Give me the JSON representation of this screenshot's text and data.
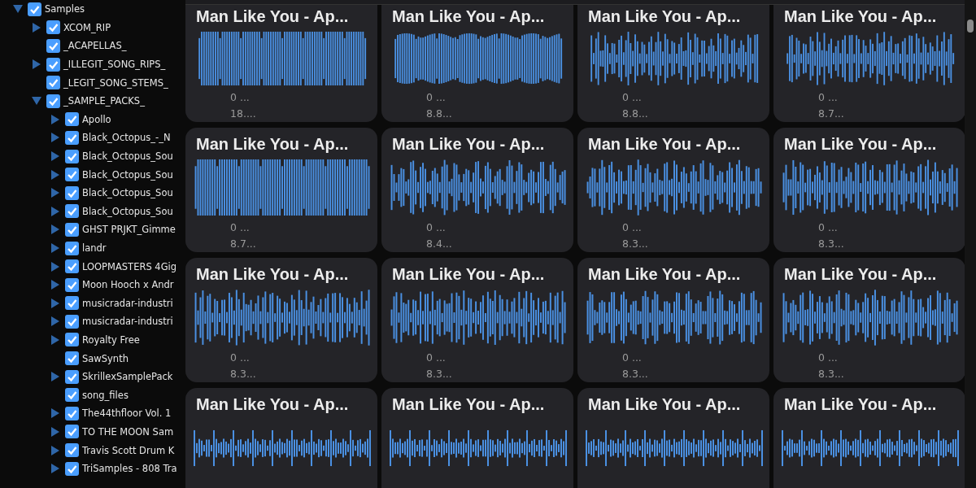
{
  "tree": {
    "label": "Samples",
    "checked": true,
    "expandable": true,
    "expanded": true,
    "children": [
      {
        "label": "XCOM_RIP",
        "checked": true,
        "expandable": true,
        "expanded": false
      },
      {
        "label": "_ACAPELLAS_",
        "checked": true,
        "expandable": false
      },
      {
        "label": "_ILLEGIT_SONG_RIPS_",
        "checked": true,
        "expandable": true,
        "expanded": false
      },
      {
        "label": "_LEGIT_SONG_STEMS_",
        "checked": true,
        "expandable": false
      },
      {
        "label": "_SAMPLE_PACKS_",
        "checked": true,
        "expandable": true,
        "expanded": true,
        "children": [
          {
            "label": "Apollo",
            "checked": true,
            "expandable": true,
            "expanded": false
          },
          {
            "label": "Black_Octopus_-_N",
            "checked": true,
            "expandable": true,
            "expanded": false
          },
          {
            "label": "Black_Octopus_Sou",
            "checked": true,
            "expandable": true,
            "expanded": false
          },
          {
            "label": "Black_Octopus_Sou",
            "checked": true,
            "expandable": true,
            "expanded": false
          },
          {
            "label": "Black_Octopus_Sou",
            "checked": true,
            "expandable": true,
            "expanded": false
          },
          {
            "label": "Black_Octopus_Sou",
            "checked": true,
            "expandable": true,
            "expanded": false
          },
          {
            "label": "GHST PRJKT_Gimme",
            "checked": true,
            "expandable": true,
            "expanded": false
          },
          {
            "label": "landr",
            "checked": true,
            "expandable": true,
            "expanded": false
          },
          {
            "label": "LOOPMASTERS 4Gig",
            "checked": true,
            "expandable": true,
            "expanded": false
          },
          {
            "label": "Moon Hooch x Andr",
            "checked": true,
            "expandable": true,
            "expanded": false
          },
          {
            "label": "musicradar-industri",
            "checked": true,
            "expandable": true,
            "expanded": false
          },
          {
            "label": "musicradar-industri",
            "checked": true,
            "expandable": true,
            "expanded": false
          },
          {
            "label": "Royalty Free",
            "checked": true,
            "expandable": true,
            "expanded": false
          },
          {
            "label": "SawSynth",
            "checked": true,
            "expandable": false
          },
          {
            "label": "SkrillexSamplePack",
            "checked": true,
            "expandable": true,
            "expanded": false
          },
          {
            "label": "song_files",
            "checked": true,
            "expandable": false
          },
          {
            "label": "The44thfloor Vol. 1",
            "checked": true,
            "expandable": true,
            "expanded": false
          },
          {
            "label": "TO THE MOON Sam",
            "checked": true,
            "expandable": true,
            "expanded": false
          },
          {
            "label": "Travis Scott Drum K",
            "checked": true,
            "expandable": true,
            "expanded": false
          },
          {
            "label": "TriSamples - 808 Tra",
            "checked": true,
            "expandable": true,
            "expanded": false
          }
        ]
      }
    ]
  },
  "cards": [
    {
      "title": "Man Like You - Ap...",
      "meta": [
        "0 ...",
        "18...."
      ]
    },
    {
      "title": "Man Like You - Ap...",
      "meta": [
        "0 ...",
        "8.8..."
      ]
    },
    {
      "title": "Man Like You - Ap...",
      "meta": [
        "0 ...",
        "8.8..."
      ]
    },
    {
      "title": "Man Like You - Ap...",
      "meta": [
        "0 ...",
        "8.7..."
      ]
    },
    {
      "title": "Man Like You - Ap...",
      "meta": [
        "0 ...",
        "8.7..."
      ]
    },
    {
      "title": "Man Like You - Ap...",
      "meta": [
        "0 ...",
        "8.4..."
      ]
    },
    {
      "title": "Man Like You - Ap...",
      "meta": [
        "0 ...",
        "8.3..."
      ]
    },
    {
      "title": "Man Like You - Ap...",
      "meta": [
        "0 ...",
        "8.3..."
      ]
    },
    {
      "title": "Man Like You - Ap...",
      "meta": [
        "0 ...",
        "8.3..."
      ]
    },
    {
      "title": "Man Like You - Ap...",
      "meta": [
        "0 ...",
        "8.3..."
      ]
    },
    {
      "title": "Man Like You - Ap...",
      "meta": [
        "0 ...",
        "8.3..."
      ]
    },
    {
      "title": "Man Like You - Ap...",
      "meta": [
        "0 ...",
        "8.3..."
      ]
    },
    {
      "title": "Man Like You - Ap..."
    },
    {
      "title": "Man Like You - Ap..."
    },
    {
      "title": "Man Like You - Ap..."
    },
    {
      "title": "Man Like You - Ap..."
    }
  ]
}
